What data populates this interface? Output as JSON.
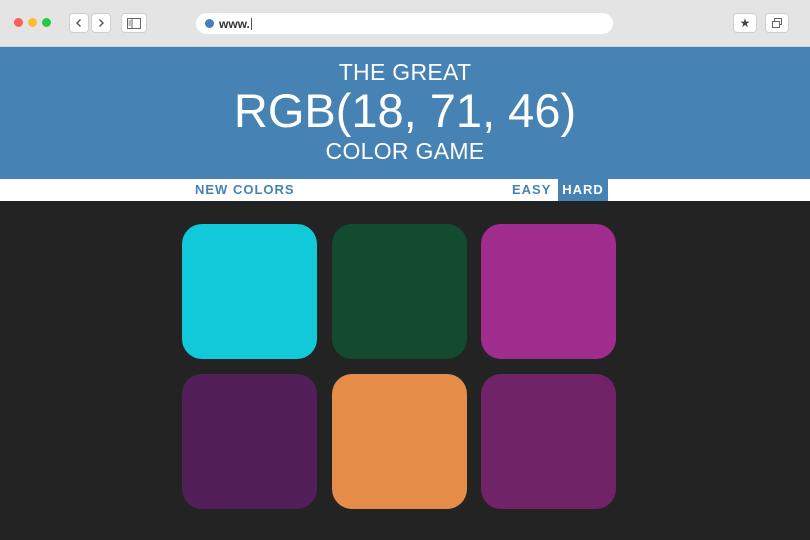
{
  "browser": {
    "url_text": "www.",
    "icons": {
      "back": "chevron-left-icon",
      "forward": "chevron-right-icon",
      "sidebar": "sidebar-icon",
      "bookmark": "star-icon",
      "tabs": "tabs-icon"
    },
    "star_glyph": "★"
  },
  "header": {
    "line_top": "THE GREAT",
    "rgb_target": "RGB(18, 71, 46)",
    "line_bottom": "COLOR GAME",
    "color": "#4682b4"
  },
  "controls": {
    "new_colors": "NEW COLORS",
    "easy": "EASY",
    "hard": "HARD",
    "selected_mode": "HARD"
  },
  "squares": [
    {
      "color": "#11c9d9"
    },
    {
      "color": "#124b2f"
    },
    {
      "color": "#a02d8d"
    },
    {
      "color": "#521f58"
    },
    {
      "color": "#e58c48"
    },
    {
      "color": "#702366"
    }
  ],
  "colors": {
    "background": "#232323",
    "accent": "#4682b4"
  }
}
